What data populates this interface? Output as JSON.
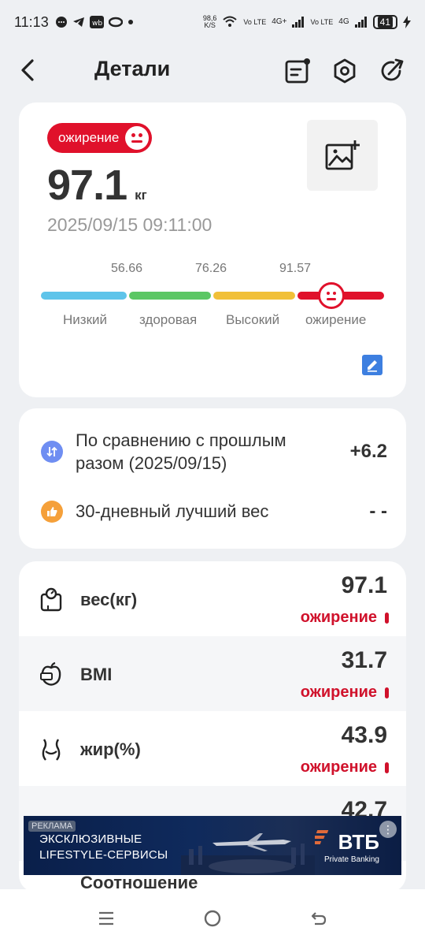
{
  "status": {
    "time": "11:13",
    "speed": "98,6",
    "speed_unit": "K/S",
    "net1": "Vo LTE",
    "net2": "4G+",
    "net3": "Vo LTE",
    "net4": "4G",
    "battery": "41"
  },
  "header": {
    "title": "Детали"
  },
  "summary": {
    "badge": "ожирение",
    "weight": "97.1",
    "unit": "кг",
    "datetime": "2025/09/15 09:11:00",
    "thresholds": [
      "56.66",
      "76.26",
      "91.57"
    ],
    "categories": [
      "Низкий",
      "здоровая",
      "Высокий",
      "ожирение"
    ],
    "colors": [
      "#5ec4ea",
      "#5cc765",
      "#f1c038",
      "#e0112b"
    ]
  },
  "compare": {
    "prev_label": "По сравнению с прошлым разом (2025/09/15)",
    "prev_value": "+6.2",
    "best_label": "30-дневный лучший вес",
    "best_value": "- -"
  },
  "metrics": [
    {
      "icon": "scale-icon",
      "name": "вес(кг)",
      "value": "97.1",
      "status": "ожирение"
    },
    {
      "icon": "bmi-icon",
      "name": "BMI",
      "value": "31.7",
      "status": "ожирение"
    },
    {
      "icon": "body-fat-icon",
      "name": "жир(%)",
      "value": "43.9",
      "status": "ожирение"
    },
    {
      "icon": "partial-icon",
      "name": "",
      "value": "42.7",
      "status": ""
    }
  ],
  "next_label": "Соотношение",
  "ad": {
    "tag": "РЕКЛАМА",
    "line1": "ЭКСКЛЮЗИВНЫЕ",
    "line2": "LIFESTYLE-СЕРВИСЫ",
    "brand": "ВТБ",
    "brand_sub": "Private Banking"
  }
}
